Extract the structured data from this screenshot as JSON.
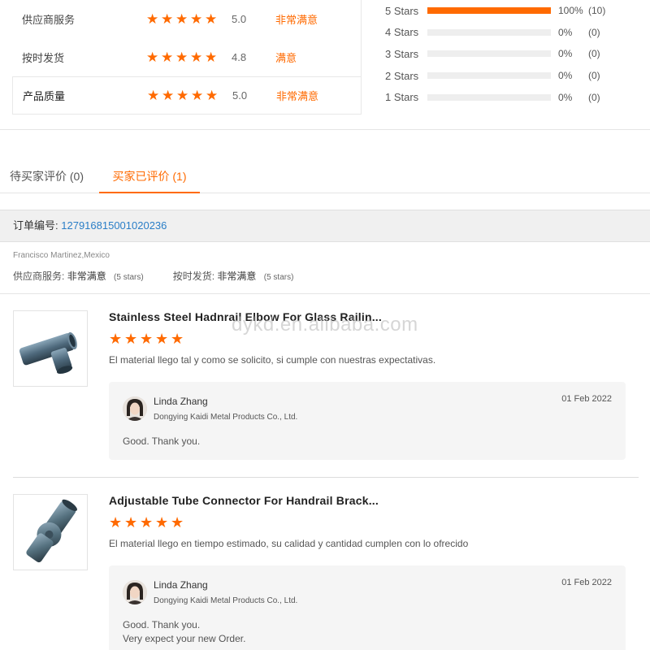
{
  "seller_ratings": [
    {
      "label": "供应商服务",
      "score": "5.0",
      "verdict": "非常满意",
      "stars": 5
    },
    {
      "label": "按时发货",
      "score": "4.8",
      "verdict": "满意",
      "stars": 4.8
    },
    {
      "label": "产品质量",
      "score": "5.0",
      "verdict": "非常满意",
      "stars": 5
    }
  ],
  "star_distribution": [
    {
      "label": "5 Stars",
      "percent": "100%",
      "count": "(10)",
      "fill": 1.0
    },
    {
      "label": "4 Stars",
      "percent": "0%",
      "count": "(0)",
      "fill": 0
    },
    {
      "label": "3 Stars",
      "percent": "0%",
      "count": "(0)",
      "fill": 0
    },
    {
      "label": "2 Stars",
      "percent": "0%",
      "count": "(0)",
      "fill": 0
    },
    {
      "label": "1 Stars",
      "percent": "0%",
      "count": "(0)",
      "fill": 0
    }
  ],
  "colors": {
    "accent": "#ff6a00",
    "link": "#2a7ec7"
  },
  "tabs": {
    "pending": "待买家评价 (0)",
    "reviewed": "买家已评价 (1)"
  },
  "order": {
    "label": "订单编号:",
    "number": "127916815001020236"
  },
  "buyer": {
    "name_location": "Francisco Martinez,Mexico",
    "service_label": "供应商服务:",
    "service_value": "非常满意",
    "service_stars": "(5 stars)",
    "shipping_label": "按时发货:",
    "shipping_value": "非常满意",
    "shipping_stars": "(5 stars)"
  },
  "watermark": "dykd.en.alibaba.com",
  "reviews": [
    {
      "title": "Stainless Steel Hadnrail Elbow For Glass Railin...",
      "stars": 5,
      "comment": "El material llego tal y como se solicito, si cumple con nuestras expectativas.",
      "reply": {
        "name": "Linda Zhang",
        "company": "Dongying Kaidi Metal Products Co., Ltd.",
        "date": "01 Feb 2022",
        "line1": "Good. Thank you.",
        "line2": ""
      }
    },
    {
      "title": "Adjustable Tube Connector For Handrail Brack...",
      "stars": 5,
      "comment": "El material llego en tiempo estimado, su calidad y cantidad cumplen con lo ofrecido",
      "reply": {
        "name": "Linda Zhang",
        "company": "Dongying Kaidi Metal Products Co., Ltd.",
        "date": "01 Feb 2022",
        "line1": "Good. Thank you.",
        "line2": "Very expect your new Order."
      }
    }
  ]
}
